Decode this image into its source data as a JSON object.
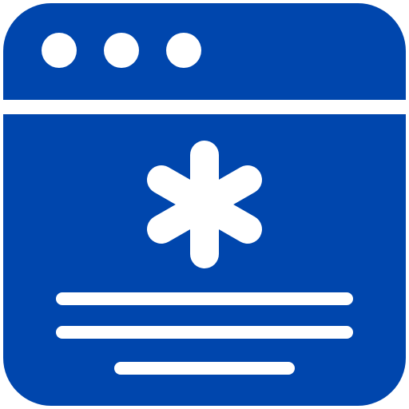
{
  "icon": {
    "name": "medical-web-page-icon",
    "colors": {
      "primary": "#0046AD",
      "foreground": "#FFFFFF",
      "background": "#FFFFFF"
    },
    "parts": {
      "window_dots": [
        "window-dot",
        "window-dot",
        "window-dot"
      ],
      "symbol": "asterisk-icon",
      "text_lines": [
        "text-line",
        "text-line",
        "text-line"
      ]
    }
  }
}
